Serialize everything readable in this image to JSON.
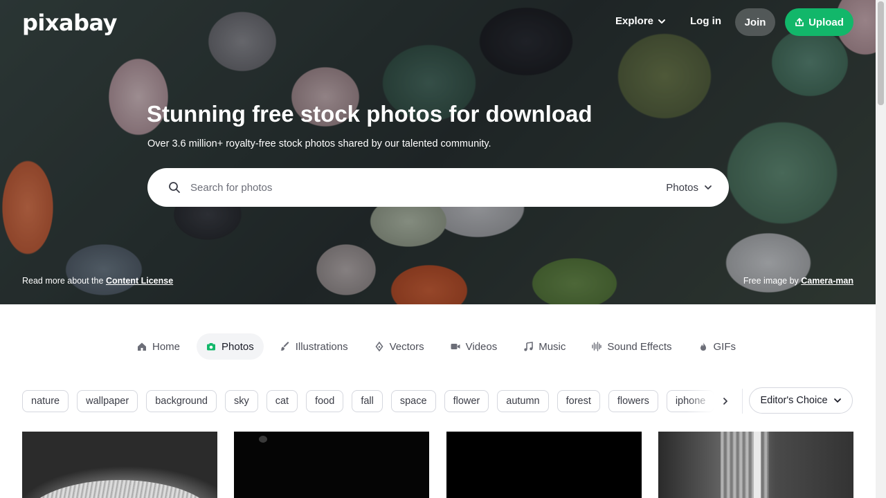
{
  "header": {
    "logo": "pixabay",
    "explore_label": "Explore",
    "login_label": "Log in",
    "join_label": "Join",
    "upload_label": "Upload"
  },
  "hero": {
    "title": "Stunning free stock photos for download",
    "subtitle": "Over 3.6 million+ royalty-free stock photos shared by our talented community.",
    "license_prefix": "Read more about the",
    "license_link": "Content License",
    "credit_prefix": "Free image by",
    "credit_link": "Camera-man"
  },
  "search": {
    "placeholder": "Search for photos",
    "type_label": "Photos"
  },
  "tabs": [
    {
      "label": "Home",
      "icon": "home-icon"
    },
    {
      "label": "Photos",
      "icon": "camera-icon",
      "active": true
    },
    {
      "label": "Illustrations",
      "icon": "brush-icon"
    },
    {
      "label": "Vectors",
      "icon": "pen-nib-icon"
    },
    {
      "label": "Videos",
      "icon": "video-icon"
    },
    {
      "label": "Music",
      "icon": "music-note-icon"
    },
    {
      "label": "Sound Effects",
      "icon": "waveform-icon"
    },
    {
      "label": "GIFs",
      "icon": "flame-icon"
    }
  ],
  "chips": [
    "nature",
    "wallpaper",
    "background",
    "sky",
    "cat",
    "food",
    "fall",
    "space",
    "flower",
    "autumn",
    "forest",
    "flowers",
    "iphone"
  ],
  "filter": {
    "editors_choice_label": "Editor's Choice"
  },
  "colors": {
    "accent_green": "#12b76a",
    "active_tab_bg": "#f3f4f6"
  }
}
